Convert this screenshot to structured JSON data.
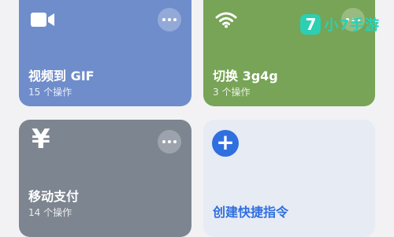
{
  "cards": [
    {
      "title": "视频到 GIF",
      "subtitle": "15 个操作",
      "icon": "video-camera-icon",
      "color": "#6f8dcb"
    },
    {
      "title": "切换 3g4g",
      "subtitle": "3 个操作",
      "icon": "wifi-icon",
      "color": "#77a456"
    },
    {
      "title": "移动支付",
      "subtitle": "14 个操作",
      "icon": "yen-icon",
      "color": "#7d8590"
    }
  ],
  "create": {
    "label": "创建快捷指令",
    "icon": "plus-icon",
    "accent": "#2f6fe0"
  },
  "watermark": {
    "badge": "7",
    "text": "小7手游",
    "color": "#2bd0b2"
  }
}
